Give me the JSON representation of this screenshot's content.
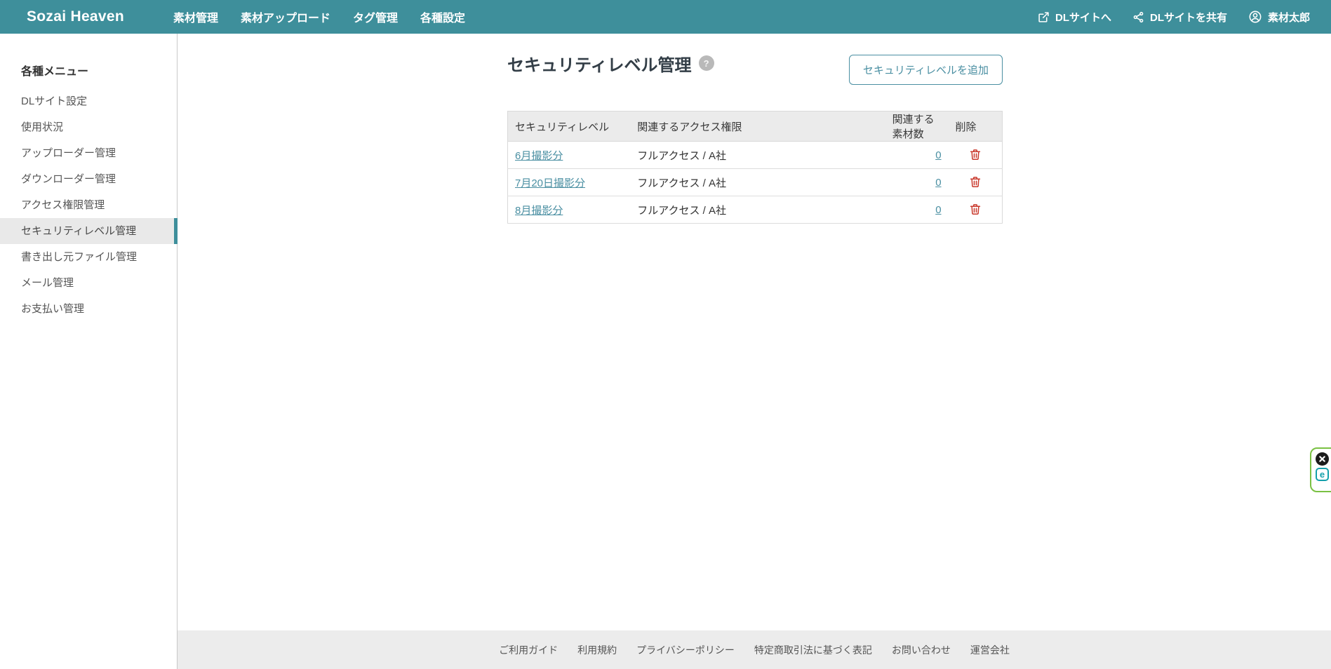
{
  "header": {
    "brand": "Sozai Heaven",
    "nav": [
      "素材管理",
      "素材アップロード",
      "タグ管理",
      "各種設定"
    ],
    "actions": [
      {
        "icon": "external-link-icon",
        "label": "DLサイトへ"
      },
      {
        "icon": "share-icon",
        "label": "DLサイトを共有"
      },
      {
        "icon": "user-circle-icon",
        "label": "素材太郎"
      }
    ]
  },
  "sidebar": {
    "title": "各種メニュー",
    "items": [
      {
        "label": "DLサイト設定",
        "active": false
      },
      {
        "label": "使用状況",
        "active": false
      },
      {
        "label": "アップローダー管理",
        "active": false
      },
      {
        "label": "ダウンローダー管理",
        "active": false
      },
      {
        "label": "アクセス権限管理",
        "active": false
      },
      {
        "label": "セキュリティレベル管理",
        "active": true
      },
      {
        "label": "書き出し元ファイル管理",
        "active": false
      },
      {
        "label": "メール管理",
        "active": false
      },
      {
        "label": "お支払い管理",
        "active": false
      }
    ]
  },
  "main": {
    "page_title": "セキュリティレベル管理",
    "help_label": "?",
    "add_button": "セキュリティレベルを追加",
    "table": {
      "columns": [
        "セキュリティレベル",
        "関連するアクセス権限",
        "関連する素材数",
        "削除"
      ],
      "rows": [
        {
          "level": "6月撮影分",
          "access": "フルアクセス / A社",
          "count": "0"
        },
        {
          "level": "7月20日撮影分",
          "access": "フルアクセス / A社",
          "count": "0"
        },
        {
          "level": "8月撮影分",
          "access": "フルアクセス / A社",
          "count": "0"
        }
      ]
    }
  },
  "footer": {
    "links": [
      "ご利用ガイド",
      "利用規約",
      "プライバシーポリシー",
      "特定商取引法に基づく表記",
      "お問い合わせ",
      "運営会社"
    ]
  },
  "promo_widget": {
    "badge_label": "e"
  },
  "colors": {
    "accent_teal": "#3e8f9b",
    "link_teal": "#4a8fa2",
    "danger_red": "#c9392c",
    "promo_green": "#7ac143",
    "table_header_bg": "#ebebeb",
    "footer_bg": "#ececec"
  }
}
